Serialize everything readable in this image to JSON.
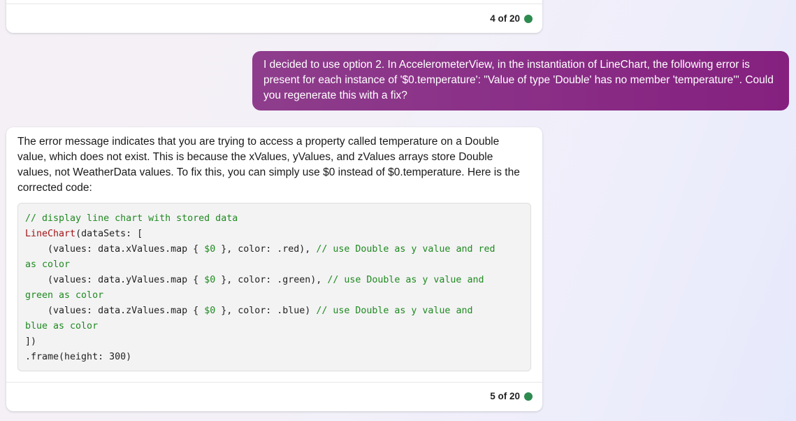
{
  "prev_response": {
    "counter": "4 of 20"
  },
  "user_message": {
    "text": "I decided to use option 2. In AccelerometerView, in the instantiation of LineChart, the following error is present for each instance of '$0.temperature': \"Value of type 'Double' has no member 'temperature'\". Could you regenerate this with a fix?"
  },
  "response": {
    "text": "The error message indicates that you are trying to access a property called temperature on a Double value, which does not exist. This is because the xValues, yValues, and zValues arrays store Double values, not WeatherData values. To fix this, you can simply use $0 instead of $0.temperature. Here is the corrected code:",
    "code": {
      "l1": "// display line chart with stored data",
      "l2_type": "LineChart",
      "l2_rest": "(dataSets: [",
      "l3_a": "    (values: data.xValues.map { ",
      "l3_var": "$0",
      "l3_b": " }, color: .red), ",
      "l3_cm": "// use Double as y value and red",
      "l4_cm": "as color",
      "l5_a": "    (values: data.yValues.map { ",
      "l5_var": "$0",
      "l5_b": " }, color: .green), ",
      "l5_cm": "// use Double as y value and",
      "l6_cm": "green as color",
      "l7_a": "    (values: data.zValues.map { ",
      "l7_var": "$0",
      "l7_b": " }, color: .blue) ",
      "l7_cm": "// use Double as y value and",
      "l8_cm": "blue as color",
      "l9": "])",
      "l10": ".frame(height: 300)"
    },
    "counter": "5 of 20"
  },
  "colors": {
    "status_dot": "#2e8b50",
    "user_bubble": "#8a2f87"
  }
}
